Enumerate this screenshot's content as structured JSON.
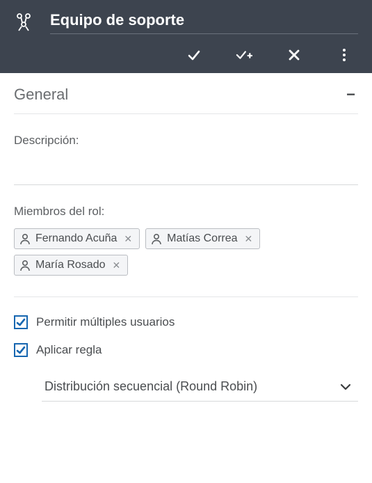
{
  "header": {
    "title": "Equipo de soporte"
  },
  "section": {
    "title": "General"
  },
  "fields": {
    "description_label": "Descripción:",
    "members_label": "Miembros del rol:"
  },
  "members": [
    {
      "name": "Fernando Acuña"
    },
    {
      "name": "Matías Correa"
    },
    {
      "name": "María Rosado"
    }
  ],
  "checkboxes": {
    "multiple_users": {
      "label": "Permitir múltiples usuarios",
      "checked": true
    },
    "apply_rule": {
      "label": "Aplicar regla",
      "checked": true
    }
  },
  "rule_select": {
    "value": "Distribución secuencial (Round Robin)"
  },
  "colors": {
    "header_bg": "#3d444f",
    "accent": "#1666b0"
  }
}
